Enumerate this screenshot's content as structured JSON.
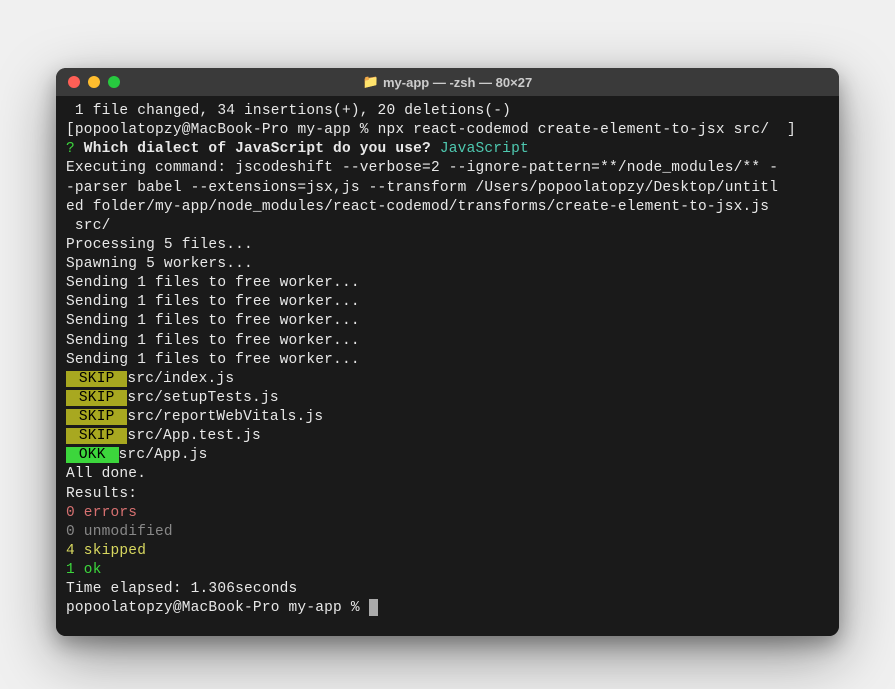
{
  "window": {
    "title_folder": "📁",
    "title": "my-app — -zsh — 80×27"
  },
  "terminal": {
    "summary_line": " 1 file changed, 34 insertions(+), 20 deletions(-)",
    "prompt_open": "[",
    "prompt_user": "popoolatopzy@MacBook-Pro my-app % ",
    "command": "npx react-codemod create-element-to-jsx src/  ",
    "prompt_close": "]",
    "question_mark": "?",
    "question_text": " Which dialect of JavaScript do you use? ",
    "question_answer": "JavaScript",
    "exec_line1": "Executing command: jscodeshift --verbose=2 --ignore-pattern=**/node_modules/** -",
    "exec_line2": "-parser babel --extensions=jsx,js --transform /Users/popoolatopzy/Desktop/untitl",
    "exec_line3": "ed folder/my-app/node_modules/react-codemod/transforms/create-element-to-jsx.js",
    "exec_line4": " src/",
    "processing": "Processing 5 files...",
    "spawning": "Spawning 5 workers...",
    "sending": [
      "Sending 1 files to free worker...",
      "Sending 1 files to free worker...",
      "Sending 1 files to free worker...",
      "Sending 1 files to free worker...",
      "Sending 1 files to free worker..."
    ],
    "file_results": [
      {
        "badge": " SKIP ",
        "type": "skip",
        "path": "src/index.js"
      },
      {
        "badge": " SKIP ",
        "type": "skip",
        "path": "src/setupTests.js"
      },
      {
        "badge": " SKIP ",
        "type": "skip",
        "path": "src/reportWebVitals.js"
      },
      {
        "badge": " SKIP ",
        "type": "skip",
        "path": "src/App.test.js"
      },
      {
        "badge": " OKK ",
        "type": "ok",
        "path": "src/App.js"
      }
    ],
    "all_done": "All done.",
    "results_label": "Results:",
    "results": {
      "errors": "0 errors",
      "unmodified": "0 unmodified",
      "skipped": "4 skipped",
      "ok": "1 ok"
    },
    "time_elapsed": "Time elapsed: 1.306seconds",
    "final_prompt": "popoolatopzy@MacBook-Pro my-app % "
  }
}
